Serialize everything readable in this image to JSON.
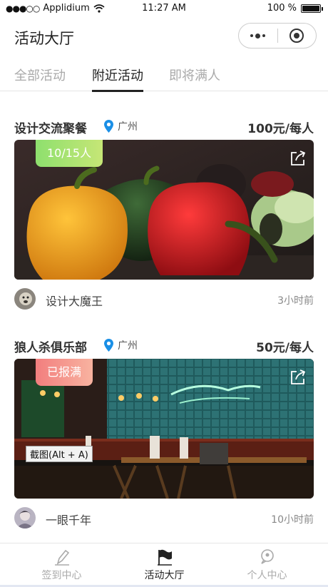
{
  "status_bar": {
    "signal": "●●●○○",
    "carrier": "Applidium",
    "time": "11:27 AM",
    "battery": "100 %",
    "battery_level": 1.0,
    "icons": [
      "wifi-icon",
      "battery-icon"
    ]
  },
  "nav": {
    "title": "活动大厅",
    "capsule_icons": [
      "more-dots-icon",
      "close-target-icon"
    ]
  },
  "tabs": [
    {
      "label": "全部活动",
      "active": false
    },
    {
      "label": "附近活动",
      "active": true
    },
    {
      "label": "即将满人",
      "active": false
    }
  ],
  "events": [
    {
      "title": "设计交流聚餐",
      "location": "广州",
      "price": "100元/每人",
      "badge": "10/15人",
      "badge_colors": [
        "#8ee06e",
        "#c6e676"
      ],
      "host": "设计大魔王",
      "time_ago": "3小时前",
      "photo": "vegetables-photo"
    },
    {
      "title": "狼人杀俱乐部",
      "location": "广州",
      "price": "50元/每人",
      "badge": "已报满",
      "badge_colors": [
        "#f27e7e",
        "#f8b3a0"
      ],
      "host": "一眼千年",
      "time_ago": "10小时前",
      "photo": "restaurant-photo",
      "overlay_tooltip": "截图(Alt + A)"
    }
  ],
  "bottom_bar": [
    {
      "label": "签到中心",
      "icon": "pen-icon",
      "active": false
    },
    {
      "label": "活动大厅",
      "icon": "flag-icon",
      "active": true
    },
    {
      "label": "个人中心",
      "icon": "chat-person-icon",
      "active": false
    }
  ],
  "colors": {
    "location_pin": "#1a8fe6",
    "text_dark": "#222222",
    "text_muted": "#aaaaaa"
  }
}
